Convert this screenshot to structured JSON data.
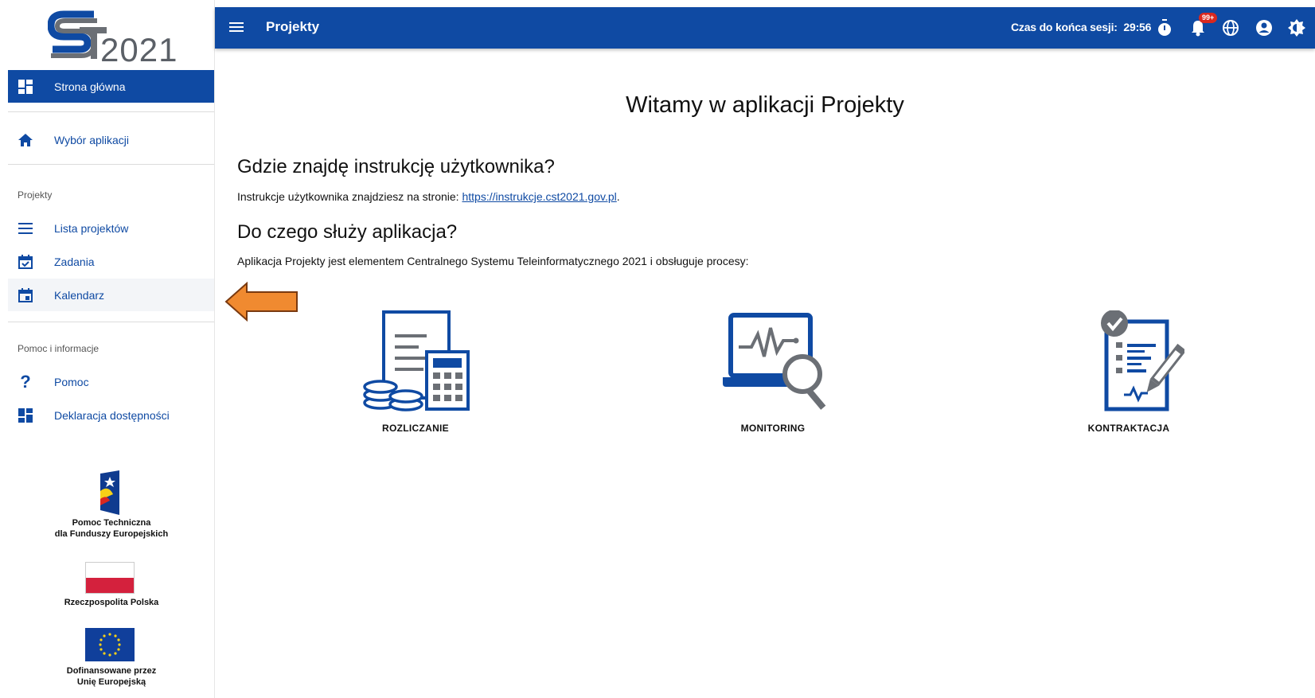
{
  "sidebar": {
    "logo_year": "2021",
    "nav_home": "Strona główna",
    "nav_apps": "Wybór aplikacji",
    "section_projects": "Projekty",
    "nav_projects_list": "Lista projektów",
    "nav_tasks": "Zadania",
    "nav_calendar": "Kalendarz",
    "section_help": "Pomoc i informacje",
    "nav_help": "Pomoc",
    "nav_accessibility": "Deklaracja dostępności",
    "partner1_line1": "Pomoc Techniczna",
    "partner1_line2": "dla Funduszy Europejskich",
    "partner2": "Rzeczpospolita Polska",
    "partner3_line1": "Dofinansowane przez",
    "partner3_line2": "Unię Europejską"
  },
  "topbar": {
    "title": "Projekty",
    "session_label": "Czas do końca sesji:",
    "session_time": "29:56",
    "notifications_badge": "99+",
    "icons": [
      "menu-icon",
      "timer-icon",
      "bell-icon",
      "globe-icon",
      "account-icon",
      "brightness-icon"
    ]
  },
  "main": {
    "welcome": "Witamy w aplikacji Projekty",
    "q1": "Gdzie znajdę instrukcję użytkownika?",
    "q1_text": "Instrukcje użytkownika znajdziesz na stronie:",
    "q1_link": "https://instrukcje.cst2021.gov.pl",
    "q1_suffix": ".",
    "q2": "Do czego służy aplikacja?",
    "q2_text": "Aplikacja Projekty jest elementem Centralnego Systemu Teleinformatycznego 2021 i obsługuje procesy:",
    "tiles": [
      "ROZLICZANIE",
      "MONITORING",
      "KONTRAKTACJA"
    ]
  },
  "colors": {
    "brand": "#0f4aa3",
    "arrow": "#f08a30",
    "badge": "#d9281f",
    "icon_gray": "#6b6f75"
  }
}
